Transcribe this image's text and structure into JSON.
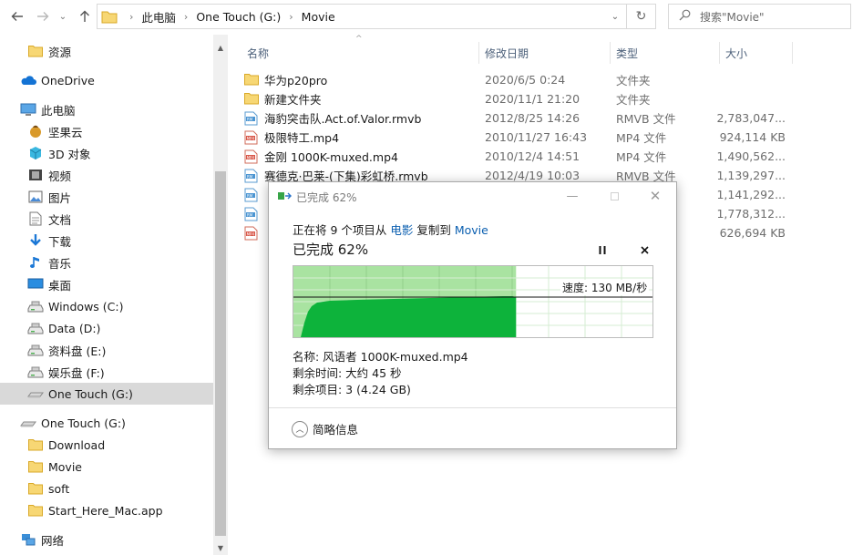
{
  "address": {
    "crumbs": [
      "此电脑",
      "One Touch (G:)",
      "Movie"
    ],
    "search_placeholder": "搜索\"Movie\""
  },
  "nav": {
    "items": [
      {
        "label": "资源",
        "icon": "folder-icon",
        "indent": 30
      },
      {
        "label": "OneDrive",
        "icon": "cloud-icon",
        "indent": 22
      },
      {
        "label": "此电脑",
        "icon": "computer-icon",
        "indent": 22
      },
      {
        "label": "坚果云",
        "icon": "nut-icon",
        "indent": 30
      },
      {
        "label": "3D 对象",
        "icon": "cube-icon",
        "indent": 30
      },
      {
        "label": "视频",
        "icon": "video-icon",
        "indent": 30
      },
      {
        "label": "图片",
        "icon": "picture-icon",
        "indent": 30
      },
      {
        "label": "文档",
        "icon": "document-icon",
        "indent": 30
      },
      {
        "label": "下载",
        "icon": "download-icon",
        "indent": 30
      },
      {
        "label": "音乐",
        "icon": "music-icon",
        "indent": 30
      },
      {
        "label": "桌面",
        "icon": "desktop-icon",
        "indent": 30
      },
      {
        "label": "Windows (C:)",
        "icon": "drive-icon",
        "indent": 30
      },
      {
        "label": "Data (D:)",
        "icon": "drive-icon",
        "indent": 30
      },
      {
        "label": "资料盘 (E:)",
        "icon": "drive-icon",
        "indent": 30
      },
      {
        "label": "娱乐盘 (F:)",
        "icon": "drive-icon",
        "indent": 30
      },
      {
        "label": "One Touch (G:)",
        "icon": "usb-drive-icon",
        "indent": 30,
        "selected": true
      },
      {
        "label": "One Touch (G:)",
        "icon": "usb-drive-icon",
        "indent": 22
      },
      {
        "label": "Download",
        "icon": "folder-icon",
        "indent": 30
      },
      {
        "label": "Movie",
        "icon": "folder-icon",
        "indent": 30
      },
      {
        "label": "soft",
        "icon": "folder-icon",
        "indent": 30
      },
      {
        "label": "Start_Here_Mac.app",
        "icon": "folder-icon",
        "indent": 30
      },
      {
        "label": "网络",
        "icon": "network-icon",
        "indent": 22
      }
    ]
  },
  "list": {
    "columns": {
      "name": "名称",
      "date": "修改日期",
      "type": "类型",
      "size": "大小"
    },
    "rows": [
      {
        "name": "华为p20pro",
        "date": "2020/6/5 0:24",
        "type": "文件夹",
        "size": "",
        "icon": "folder-icon"
      },
      {
        "name": "新建文件夹",
        "date": "2020/11/1 21:20",
        "type": "文件夹",
        "size": "",
        "icon": "folder-icon"
      },
      {
        "name": "海豹突击队.Act.of.Valor.rmvb",
        "date": "2012/8/25 14:26",
        "type": "RMVB 文件",
        "size": "2,783,047...",
        "icon": "rmvb-file-icon"
      },
      {
        "name": "极限特工.mp4",
        "date": "2010/11/27 16:43",
        "type": "MP4 文件",
        "size": "924,114 KB",
        "icon": "mp4-file-icon"
      },
      {
        "name": "金刚 1000K-muxed.mp4",
        "date": "2010/12/4 14:51",
        "type": "MP4 文件",
        "size": "1,490,562...",
        "icon": "mp4-file-icon"
      },
      {
        "name": "赛德克·巴莱-(下集)彩虹桥.rmvb",
        "date": "2012/4/19 10:03",
        "type": "RMVB 文件",
        "size": "1,139,297...",
        "icon": "rmvb-file-icon"
      },
      {
        "name": "",
        "date": "",
        "type": "",
        "size": "1,141,292...",
        "icon": "rmvb-file-icon"
      },
      {
        "name": "",
        "date": "",
        "type": "",
        "size": "1,778,312...",
        "icon": "rmvb-file-icon"
      },
      {
        "name": "",
        "date": "",
        "type": "",
        "size": "626,694 KB",
        "icon": "mp4-file-icon"
      }
    ]
  },
  "dialog": {
    "title": "已完成 62%",
    "copy_prefix": "正在将 9 个项目从 ",
    "source": "电影",
    "copy_mid": " 复制到 ",
    "dest": "Movie",
    "progress_text": "已完成 62%",
    "progress": 0.62,
    "speed": "速度: 130 MB/秒",
    "name_line": "名称: 风语者 1000K-muxed.mp4",
    "time_line": "剩余时间: 大约 45 秒",
    "items_line": "剩余项目: 3 (4.24 GB)",
    "less_details": "简略信息",
    "colors": {
      "fill_light": "#a9e3a1",
      "fill_dark": "#0db33b",
      "link": "#0b5fb0"
    }
  }
}
